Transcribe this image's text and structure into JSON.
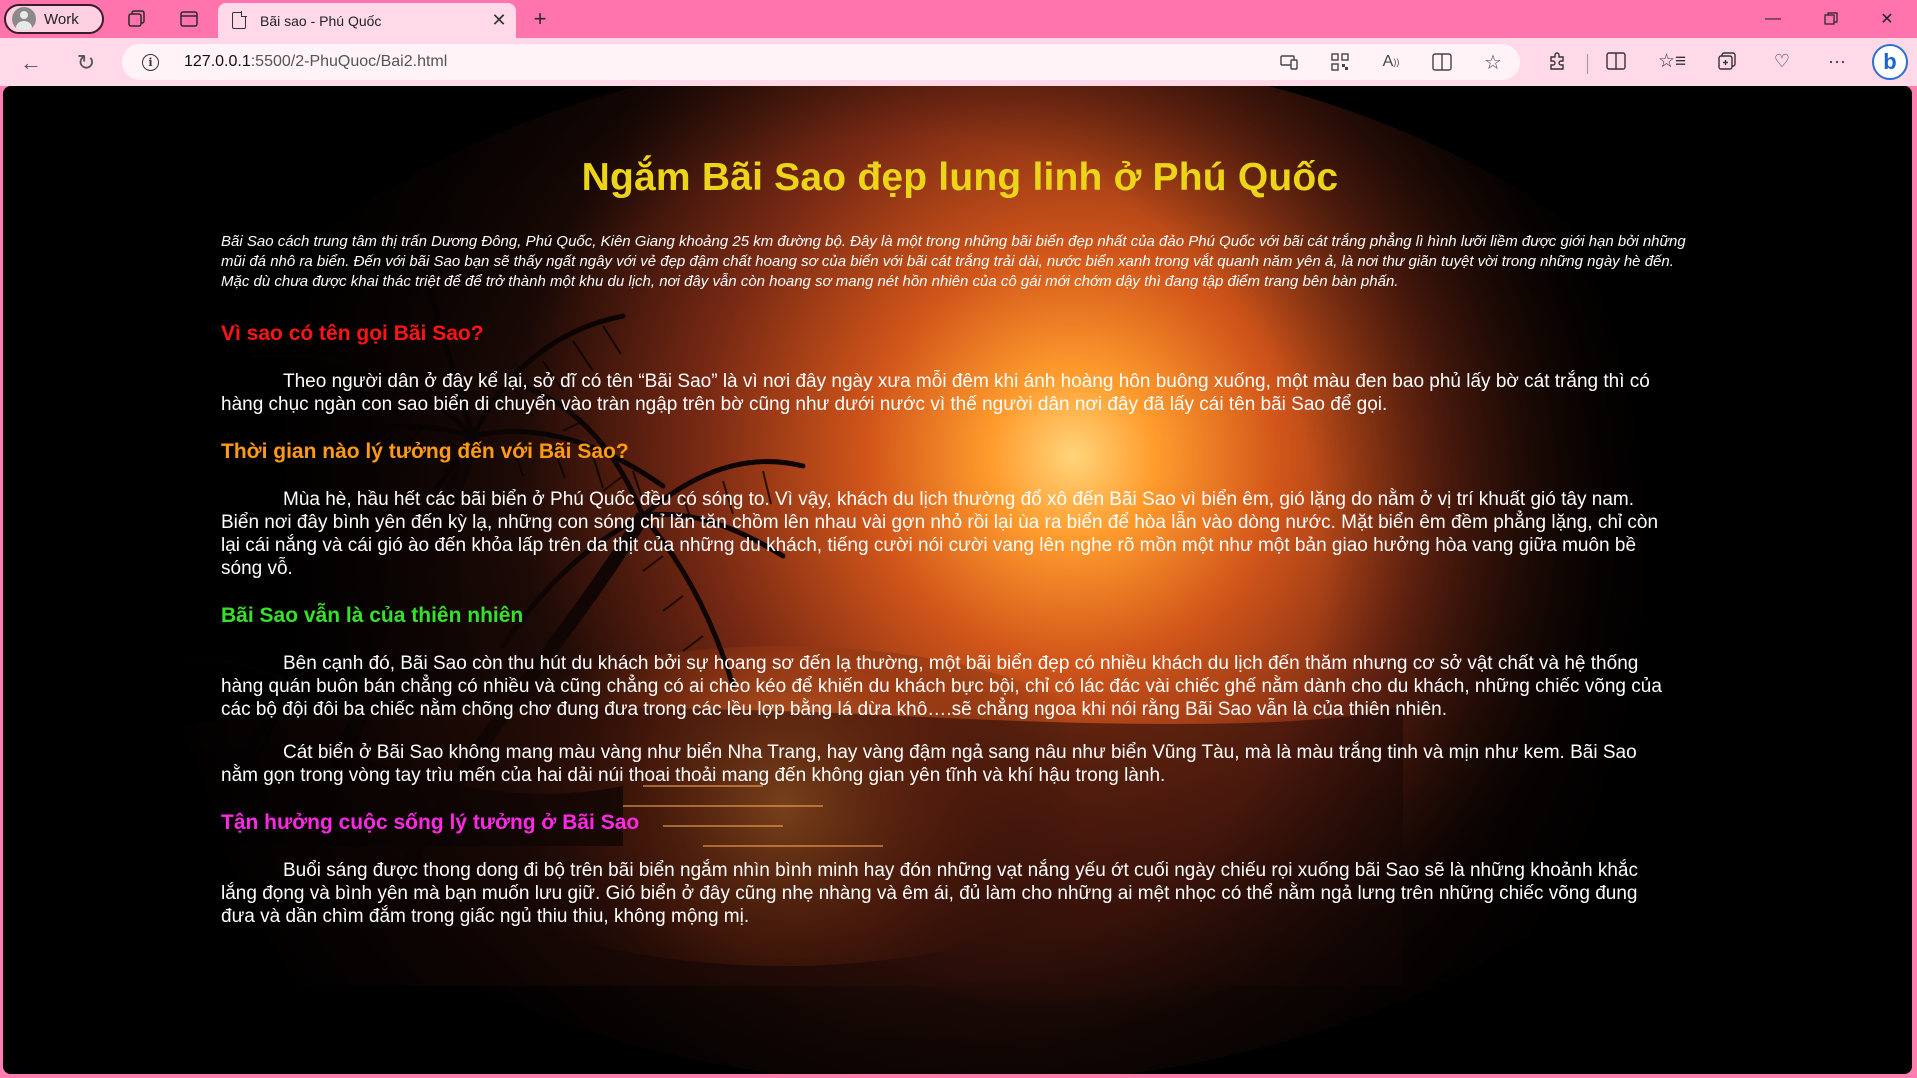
{
  "browser": {
    "profile_label": "Work",
    "tab_title": "Bãi sao - Phú Quốc",
    "url_host": "127.0.0.1",
    "url_path": ":5500/2-PhuQuoc/Bai2.html"
  },
  "icons": {
    "back": "back-arrow-icon",
    "refresh": "refresh-icon",
    "info": "info-icon",
    "favorite": "star-icon",
    "copilot": "bing-icon"
  },
  "colors": {
    "title": "#ecd419",
    "heading1": "#ff1414",
    "heading2": "#ff9a14",
    "heading3": "#36e12a",
    "heading4": "#ff28e4"
  },
  "page": {
    "title": "Ngắm Bãi Sao đẹp lung linh ở Phú Quốc",
    "intro": "Bãi Sao cách trung tâm thị trấn Dương Đông, Phú Quốc, Kiên Giang khoảng 25 km đường bộ. Đây là một trong những bãi biển đẹp nhất của đảo Phú Quốc với bãi cát trắng phẳng lì hình lưỡi liềm được giới hạn bởi những mũi đá nhô ra biển. Đến với bãi Sao bạn sẽ thấy ngất ngây với vẻ đẹp đậm chất hoang sơ của biển với bãi cát trắng trải dài, nước biển xanh trong vắt quanh năm yên ả, là nơi thư giãn tuyệt vời trong những ngày hè đến. Mặc dù chưa được khai thác triệt để để trở thành một khu du lịch, nơi đây vẫn còn hoang sơ mang nét hồn nhiên của cô gái mới chớm dậy thì đang tập điểm trang bên bàn phấn.",
    "sections": [
      {
        "heading": "Vì sao có tên gọi Bãi Sao?",
        "paragraphs": [
          "Theo người dân ở đây kể lại, sở dĩ có tên “Bãi Sao” là vì nơi đây ngày xưa mỗi đêm khi ánh hoàng hôn buông xuống, một màu đen bao phủ lấy bờ cát trắng thì có hàng chục ngàn con sao biển di chuyển vào tràn ngập trên bờ cũng như dưới nước vì thế người dân nơi đây đã lấy cái tên bãi Sao để gọi."
        ]
      },
      {
        "heading": "Thời gian nào lý tưởng đến với Bãi Sao?",
        "paragraphs": [
          "Mùa hè, hầu hết các bãi biển ở Phú Quốc đều có sóng to. Vì vậy, khách du lịch thường đổ xô đến Bãi Sao vì biển êm, gió lặng do nằm ở vị trí khuất gió tây nam. Biển nơi đây bình yên đến kỳ lạ, những con sóng chỉ lăn tăn chồm lên nhau vài gợn nhỏ rồi lại ùa ra biển để hòa lẫn vào dòng nước. Mặt biển êm đềm phẳng lặng, chỉ còn lại cái nắng và cái gió ào đến khỏa lấp trên da thịt của những du khách, tiếng cười nói cười vang lên nghe rõ mồn một như một bản giao hưởng hòa vang giữa muôn bề sóng vỗ."
        ]
      },
      {
        "heading": "Bãi Sao vẫn là của thiên nhiên",
        "paragraphs": [
          "Bên cạnh đó, Bãi Sao còn thu hút du khách bởi sự hoang sơ đến lạ thường, một bãi biển đẹp có nhiều khách du lịch đến thăm nhưng cơ sở vật chất và hệ thống hàng quán buôn bán chẳng có nhiều và cũng chẳng có ai chèo kéo để khiến du khách bực bội, chỉ có lác đác vài chiếc ghế nằm dành cho du khách, những chiếc võng của các bộ đội đôi ba chiếc nằm chõng chơ đung đưa trong các lều lợp bằng lá dừa khô….sẽ chẳng ngoa khi nói rằng Bãi Sao vẫn là của thiên nhiên.",
          "Cát biển ở Bãi Sao không mang màu vàng như biển Nha Trang, hay vàng đậm ngả sang nâu như biển Vũng Tàu, mà là màu trắng tinh và mịn như kem. Bãi Sao nằm gọn trong vòng tay trìu mến của hai dải núi thoai thoải mang đến không gian yên tĩnh và khí hậu trong lành."
        ]
      },
      {
        "heading": "Tận hưởng cuộc sống lý tưởng ở Bãi Sao",
        "paragraphs": [
          "Buổi sáng được thong dong đi bộ trên bãi biển ngắm nhìn bình minh hay đón những vạt nắng yếu ớt cuối ngày chiếu rọi xuống bãi Sao sẽ là những khoảnh khắc lắng đọng và bình yên mà bạn muốn lưu giữ. Gió biển ở đây cũng nhẹ nhàng và êm ái, đủ làm cho những ai mệt nhọc có thể nằm ngả lưng trên những chiếc võng đung đưa và dần chìm đắm trong giấc ngủ thiu thiu, không mộng mị."
        ]
      }
    ]
  }
}
